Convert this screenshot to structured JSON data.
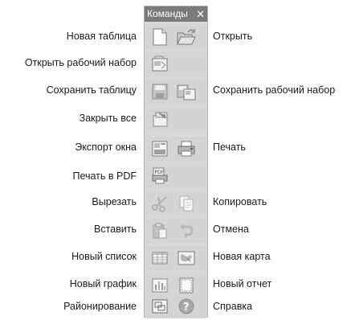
{
  "panel": {
    "title": "Команды",
    "close_glyph": "✕"
  },
  "commands": [
    {
      "label": "Новая таблица",
      "icon": "new-table-icon"
    },
    {
      "label": "Открыть",
      "icon": "open-folder-icon"
    },
    {
      "label": "Открыть рабочий набор",
      "icon": "open-workspace-icon"
    },
    {
      "label": "Сохранить таблицу",
      "icon": "save-table-icon"
    },
    {
      "label": "Сохранить рабочий набор",
      "icon": "save-workspace-icon"
    },
    {
      "label": "Закрыть все",
      "icon": "close-all-icon"
    },
    {
      "label": "Экспорт окна",
      "icon": "export-window-icon"
    },
    {
      "label": "Печать",
      "icon": "printer-icon"
    },
    {
      "label": "Печать в PDF",
      "icon": "print-pdf-icon"
    },
    {
      "label": "Вырезать",
      "icon": "scissors-icon"
    },
    {
      "label": "Копировать",
      "icon": "copy-icon"
    },
    {
      "label": "Вставить",
      "icon": "paste-icon"
    },
    {
      "label": "Отмена",
      "icon": "undo-icon"
    },
    {
      "label": "Новый список",
      "icon": "new-browser-list-icon"
    },
    {
      "label": "Новая карта",
      "icon": "new-map-icon"
    },
    {
      "label": "Новый график",
      "icon": "new-graph-icon"
    },
    {
      "label": "Новый отчет",
      "icon": "new-layout-report-icon"
    },
    {
      "label": "Районирование",
      "icon": "redistrict-icon"
    },
    {
      "label": "Справка",
      "icon": "help-icon"
    }
  ]
}
